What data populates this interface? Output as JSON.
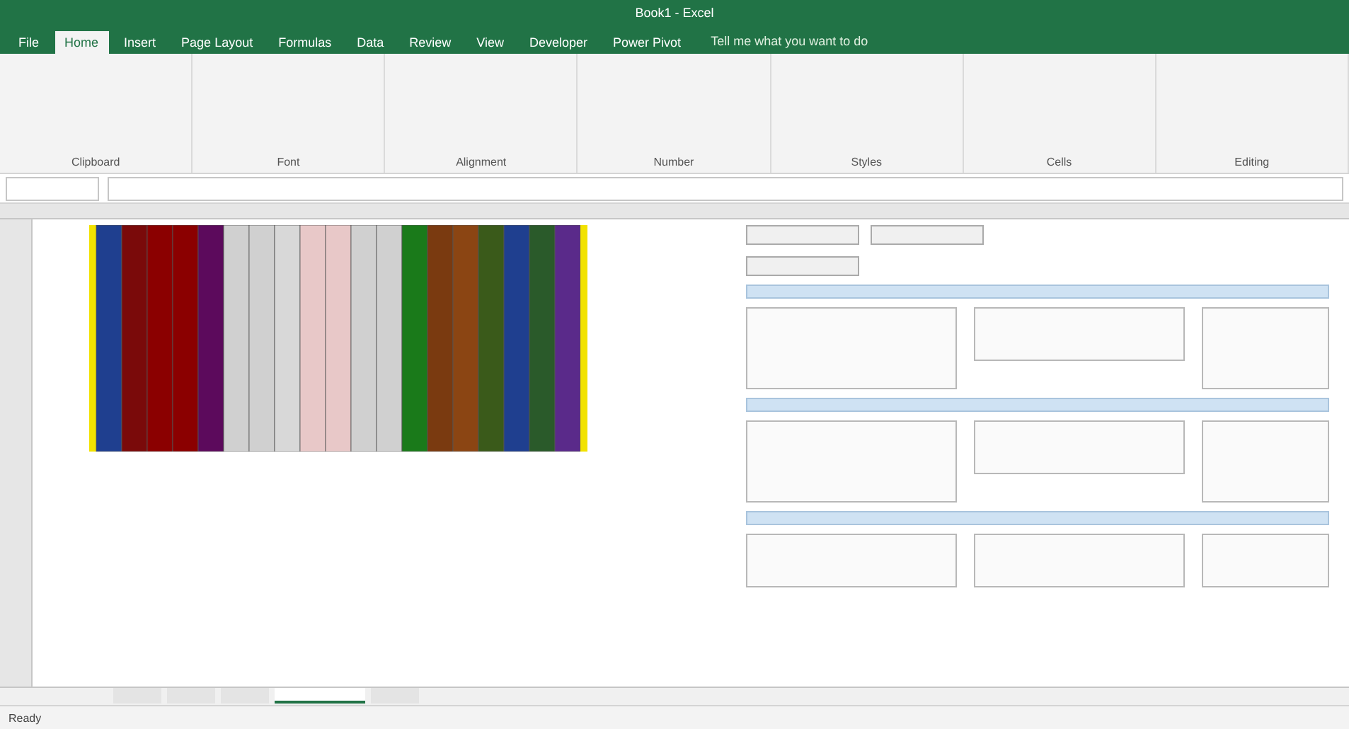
{
  "window": {
    "title": "Book1 - Excel"
  },
  "ribbon_tabs": [
    {
      "label": "File",
      "selected": false
    },
    {
      "label": "Home",
      "selected": true
    },
    {
      "label": "Insert",
      "selected": false
    },
    {
      "label": "Page Layout",
      "selected": false
    },
    {
      "label": "Formulas",
      "selected": false
    },
    {
      "label": "Data",
      "selected": false
    },
    {
      "label": "Review",
      "selected": false
    },
    {
      "label": "View",
      "selected": false
    },
    {
      "label": "Developer",
      "selected": false
    },
    {
      "label": "Power Pivot",
      "selected": false
    }
  ],
  "tell_me": {
    "placeholder": "Tell me what you want to do"
  },
  "ribbon_groups": [
    "Clipboard",
    "Font",
    "Alignment",
    "Number",
    "Styles",
    "Cells",
    "Editing"
  ],
  "heatmap": {
    "columns": [
      {
        "color": "#1f3f8f"
      },
      {
        "color": "#7a0a0a"
      },
      {
        "color": "#8b0000"
      },
      {
        "color": "#8b0000"
      },
      {
        "color": "#5c0a5c"
      },
      {
        "color": "#d0d0d0"
      },
      {
        "color": "#d0d0d0"
      },
      {
        "color": "#d8d8d8"
      },
      {
        "color": "#e8c8c8"
      },
      {
        "color": "#e8c8c8"
      },
      {
        "color": "#d0d0d0"
      },
      {
        "color": "#d0d0d0"
      },
      {
        "color": "#1a7a1a"
      },
      {
        "color": "#7a3a10"
      },
      {
        "color": "#8b4513"
      },
      {
        "color": "#3a5a1a"
      },
      {
        "color": "#1f3f8f"
      },
      {
        "color": "#2a5a2a"
      },
      {
        "color": "#5a2a8a"
      }
    ]
  },
  "top_buttons": [
    {
      "kind": "wide"
    },
    {
      "kind": "wide"
    },
    {
      "kind": "wide"
    }
  ],
  "sections": [
    {
      "cards": [
        {
          "kind": "tall"
        },
        {
          "kind": "short"
        },
        {
          "kind": "tall"
        }
      ]
    },
    {
      "cards": [
        {
          "kind": "tall"
        },
        {
          "kind": "short"
        },
        {
          "kind": "tall"
        }
      ]
    },
    {
      "cards": [
        {
          "kind": "short"
        },
        {
          "kind": "short"
        },
        {
          "kind": "short"
        }
      ]
    }
  ],
  "sheet_tabs": [
    {
      "selected": false
    },
    {
      "selected": false
    },
    {
      "selected": false
    },
    {
      "selected": true
    },
    {
      "selected": false
    }
  ],
  "status_bar": {
    "text": "Ready"
  }
}
